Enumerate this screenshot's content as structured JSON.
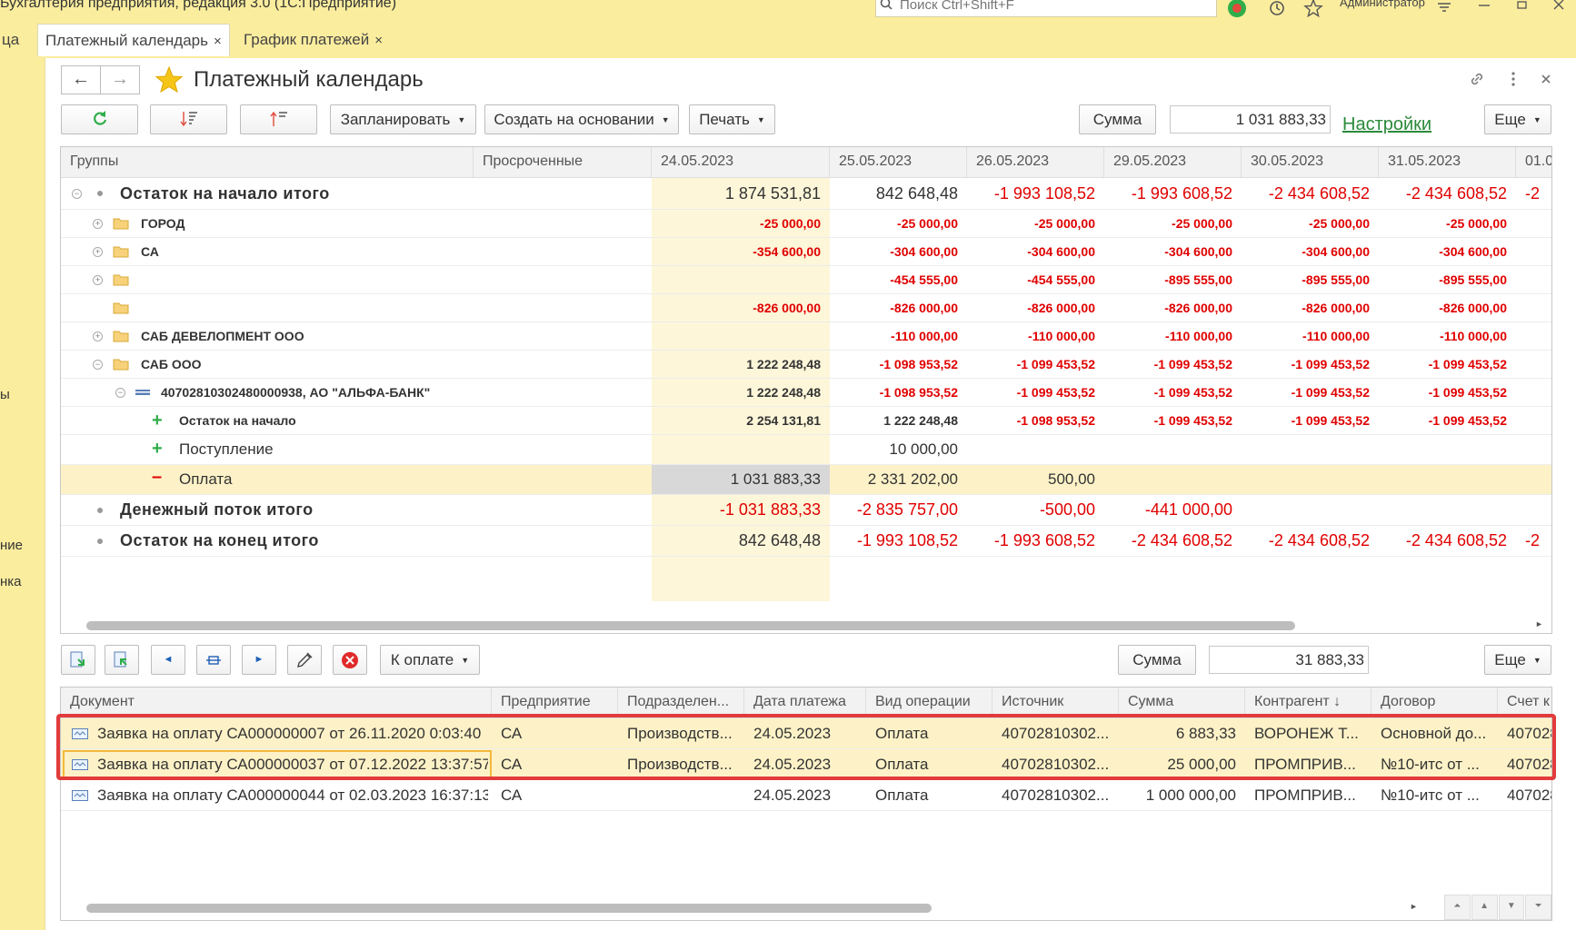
{
  "app": {
    "title": "Бухгалтерия предприятия, редакция 3.0  (1С:Предприятие)",
    "search_placeholder": "Поиск Ctrl+Shift+F",
    "user": "Администратор"
  },
  "tabs": [
    {
      "label": "ца"
    },
    {
      "label": "Платежный календарь",
      "close": "×"
    },
    {
      "label": "График платежей",
      "close": "×"
    }
  ],
  "left_strip": [
    "ы",
    "ние",
    "нка"
  ],
  "page": {
    "title": "Платежный календарь",
    "nav_back": "←",
    "nav_forward": "→"
  },
  "toolbar": {
    "plan": "Запланировать",
    "create_based": "Создать на основании",
    "print": "Печать",
    "sum_button": "Сумма",
    "sum_value": "1 031 883,33",
    "settings_link": "Настройки",
    "more": "Еще"
  },
  "top_grid": {
    "headers": [
      "Группы",
      "Просроченные",
      "24.05.2023",
      "25.05.2023",
      "26.05.2023",
      "29.05.2023",
      "30.05.2023",
      "31.05.2023",
      "01.0"
    ],
    "rows": [
      {
        "name": "Остаток на начало итого",
        "overdue": "",
        "values": [
          "1 874 531,81",
          "842 648,48",
          "-1 993 108,52",
          "-1 993 608,52",
          "-2 434 608,52",
          "-2 434 608,52",
          "-2"
        ]
      },
      {
        "name": "ГОРОД",
        "overdue": "",
        "values": [
          "-25 000,00",
          "-25 000,00",
          "-25 000,00",
          "-25 000,00",
          "-25 000,00",
          "-25 000,00",
          ""
        ]
      },
      {
        "name": "СА",
        "overdue": "",
        "values": [
          "-354 600,00",
          "-304 600,00",
          "-304 600,00",
          "-304 600,00",
          "-304 600,00",
          "-304 600,00",
          ""
        ]
      },
      {
        "name": "",
        "overdue": "",
        "values": [
          "",
          "-454 555,00",
          "-454 555,00",
          "-895 555,00",
          "-895 555,00",
          "-895 555,00",
          ""
        ]
      },
      {
        "name": "",
        "overdue": "",
        "values": [
          "-826 000,00",
          "-826 000,00",
          "-826 000,00",
          "-826 000,00",
          "-826 000,00",
          "-826 000,00",
          ""
        ]
      },
      {
        "name": "САБ ДЕВЕЛОПМЕНТ ООО",
        "overdue": "",
        "values": [
          "",
          "-110 000,00",
          "-110 000,00",
          "-110 000,00",
          "-110 000,00",
          "-110 000,00",
          ""
        ]
      },
      {
        "name": "САБ ООО",
        "overdue": "",
        "values": [
          "1 222 248,48",
          "-1 098 953,52",
          "-1 099 453,52",
          "-1 099 453,52",
          "-1 099 453,52",
          "-1 099 453,52",
          ""
        ]
      },
      {
        "name": "40702810302480000938, АО \"АЛЬФА-БАНК\"",
        "overdue": "",
        "values": [
          "1 222 248,48",
          "-1 098 953,52",
          "-1 099 453,52",
          "-1 099 453,52",
          "-1 099 453,52",
          "-1 099 453,52",
          ""
        ]
      },
      {
        "name": "Остаток на начало",
        "overdue": "",
        "values": [
          "2 254 131,81",
          "1 222 248,48",
          "-1 098 953,52",
          "-1 099 453,52",
          "-1 099 453,52",
          "-1 099 453,52",
          ""
        ]
      },
      {
        "name": "Поступление",
        "overdue": "",
        "values": [
          "",
          "10 000,00",
          "",
          "",
          "",
          "",
          ""
        ]
      },
      {
        "name": "Оплата",
        "overdue": "",
        "values": [
          "1 031 883,33",
          "2 331 202,00",
          "500,00",
          "",
          "",
          "",
          ""
        ]
      },
      {
        "name": "Денежный поток итого",
        "overdue": "",
        "values": [
          "-1 031 883,33",
          "-2 835 757,00",
          "-500,00",
          "-441 000,00",
          "",
          "",
          ""
        ]
      },
      {
        "name": "Остаток на конец итого",
        "overdue": "",
        "values": [
          "842 648,48",
          "-1 993 108,52",
          "-1 993 608,52",
          "-2 434 608,52",
          "-2 434 608,52",
          "-2 434 608,52",
          "-2"
        ]
      }
    ],
    "plus_sign": "+",
    "minus_sign": "–"
  },
  "bottom_toolbar": {
    "to_pay": "К оплате",
    "sum_button": "Сумма",
    "sum_value": "31 883,33",
    "more": "Еще"
  },
  "bottom_grid": {
    "headers": [
      "Документ",
      "Предприятие",
      "Подразделен...",
      "Дата платежа",
      "Вид операции",
      "Источник",
      "Сумма",
      "Контрагент  ↓",
      "Договор",
      "Счет к"
    ],
    "rows": [
      [
        "Заявка на оплату СА000000007 от 26.11.2020 0:03:40",
        "СА",
        "Производств...",
        "24.05.2023",
        "Оплата",
        "40702810302...",
        "6 883,33",
        "ВОРОНЕЖ Т...",
        "Основной до...",
        "407028"
      ],
      [
        "Заявка на оплату СА000000037 от 07.12.2022 13:37:57",
        "СА",
        "Производств...",
        "24.05.2023",
        "Оплата",
        "40702810302...",
        "25 000,00",
        "ПРОМПРИВ...",
        "№10-итс от ...",
        "407028"
      ],
      [
        "Заявка на оплату СА000000044 от 02.03.2023 16:37:13",
        "СА",
        "",
        "24.05.2023",
        "Оплата",
        "40702810302...",
        "1 000 000,00",
        "ПРОМПРИВ...",
        "№10-итс от ...",
        "407028"
      ]
    ]
  },
  "colors": {
    "accent_yellow": "#fbed9e",
    "negative": "#e00000",
    "link": "#2b8a3a",
    "selection_frame": "#e23b3b"
  }
}
